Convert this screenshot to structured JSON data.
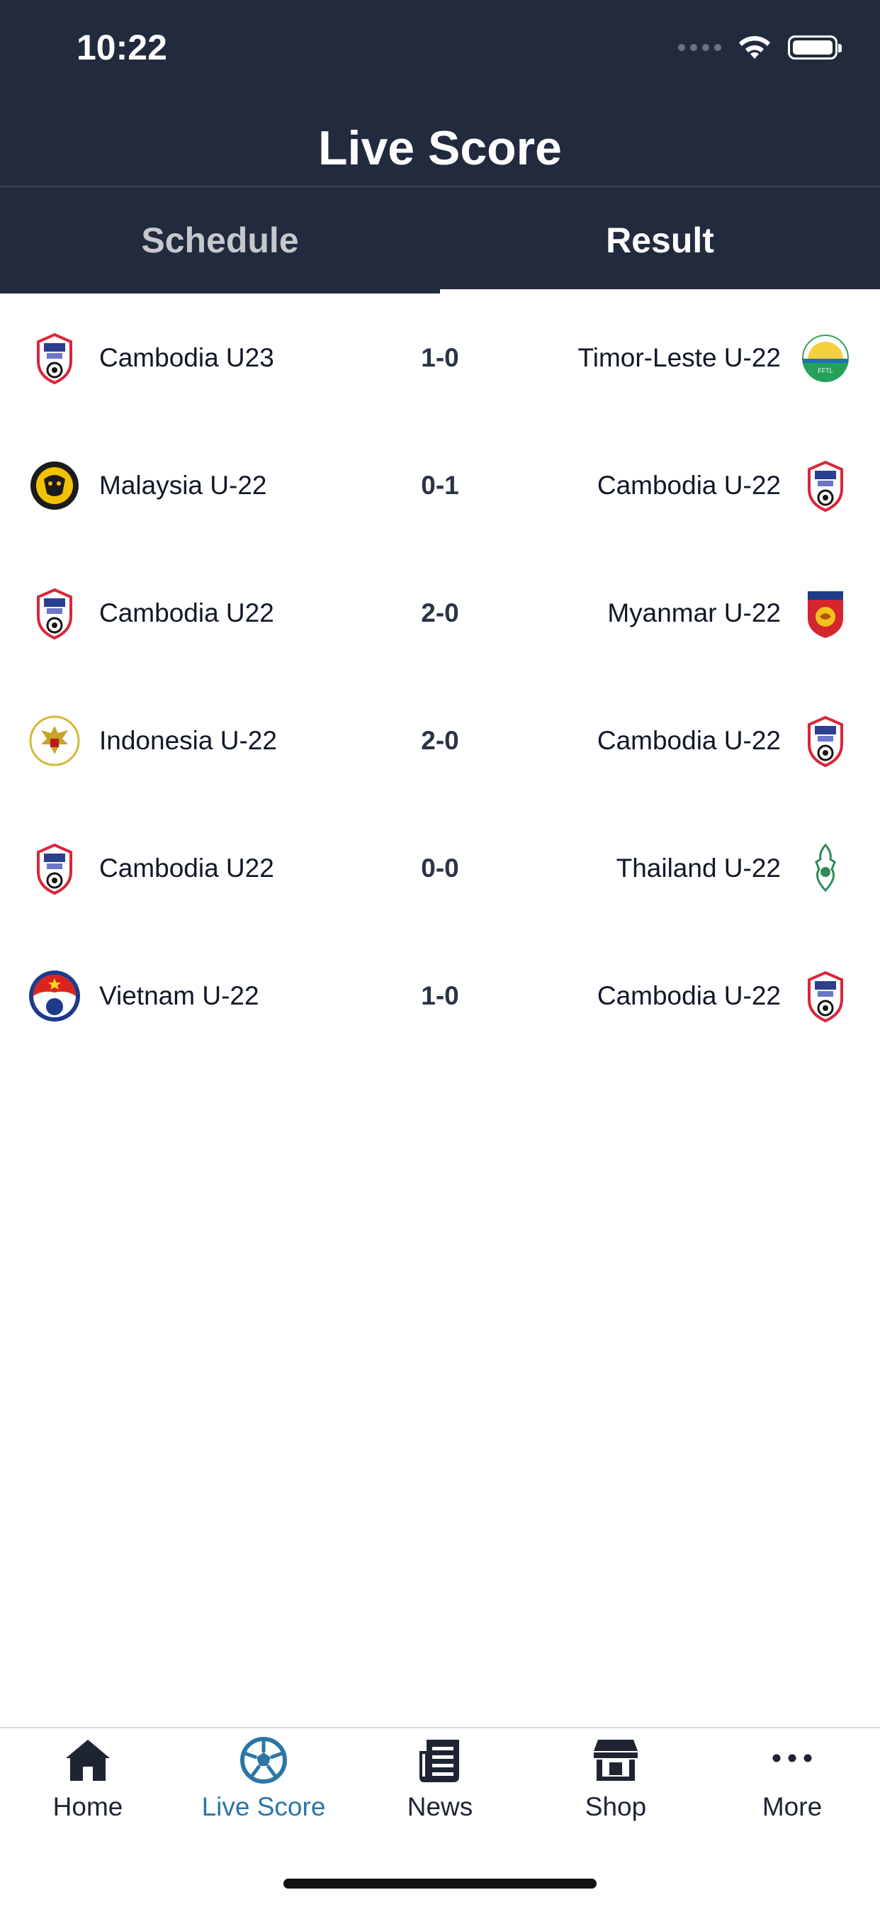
{
  "status_bar": {
    "time": "10:22"
  },
  "header": {
    "title": "Live Score"
  },
  "tabs": [
    {
      "label": "Schedule",
      "active": false
    },
    {
      "label": "Result",
      "active": true
    }
  ],
  "matches": [
    {
      "home": "Cambodia U23",
      "home_logo": "cambodia-ffc-crest",
      "score": "1-0",
      "away": "Timor-Leste U-22",
      "away_logo": "timor-leste-fftl-crest"
    },
    {
      "home": "Malaysia U-22",
      "home_logo": "malaysia-fam-crest",
      "score": "0-1",
      "away": "Cambodia U-22",
      "away_logo": "cambodia-ffc-crest"
    },
    {
      "home": "Cambodia U22",
      "home_logo": "cambodia-ffc-crest",
      "score": "2-0",
      "away": "Myanmar U-22",
      "away_logo": "myanmar-mff-crest"
    },
    {
      "home": "Indonesia U-22",
      "home_logo": "indonesia-garuda-crest",
      "score": "2-0",
      "away": "Cambodia U-22",
      "away_logo": "cambodia-ffc-crest"
    },
    {
      "home": "Cambodia U22",
      "home_logo": "cambodia-ffc-crest",
      "score": "0-0",
      "away": "Thailand U-22",
      "away_logo": "thailand-fat-crest"
    },
    {
      "home": "Vietnam U-22",
      "home_logo": "vietnam-vff-crest",
      "score": "1-0",
      "away": "Cambodia U-22",
      "away_logo": "cambodia-ffc-crest"
    }
  ],
  "bottom_nav": [
    {
      "label": "Home",
      "icon": "house-icon",
      "active": false
    },
    {
      "label": "Live Score",
      "icon": "soccer-ball-icon",
      "active": true
    },
    {
      "label": "News",
      "icon": "newspaper-icon",
      "active": false
    },
    {
      "label": "Shop",
      "icon": "storefront-icon",
      "active": false
    },
    {
      "label": "More",
      "icon": "ellipsis-icon",
      "active": false
    }
  ],
  "colors": {
    "header_bg": "#222a3e",
    "active_nav": "#2b76a6",
    "score_text": "#2a3347"
  }
}
